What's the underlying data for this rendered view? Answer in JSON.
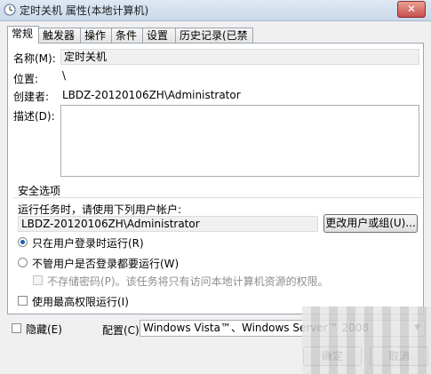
{
  "window": {
    "title": "定时关机 属性(本地计算机)",
    "close_glyph": "✕"
  },
  "tabs": [
    {
      "label": "常规"
    },
    {
      "label": "触发器"
    },
    {
      "label": "操作"
    },
    {
      "label": "条件"
    },
    {
      "label": "设置"
    },
    {
      "label": "历史记录(已禁用)"
    }
  ],
  "general": {
    "name_label": "名称(M):",
    "name_value": "定时关机",
    "location_label": "位置:",
    "location_value": "\\",
    "author_label": "创建者:",
    "author_value": "LBDZ-20120106ZH\\Administrator",
    "description_label": "描述(D):",
    "description_value": ""
  },
  "security": {
    "section_title": "安全选项",
    "run_as_label": "运行任务时，请使用下列用户帐户:",
    "user_account": "LBDZ-20120106ZH\\Administrator",
    "change_user_button": "更改用户或组(U)...",
    "radio_logged_on": "只在用户登录时运行(R)",
    "radio_logged_on_selected": true,
    "radio_whether_logged": "不管用户是否登录都要运行(W)",
    "no_store_password": "不存储密码(P)。该任务将只有访问本地计算机资源的权限。",
    "highest_privileges": "使用最高权限运行(I)"
  },
  "bottom": {
    "hidden_label": "隐藏(E)",
    "configure_label": "配置(C):",
    "configure_value": "Windows Vista™、Windows Server™ 2008",
    "ok_button": "确定",
    "cancel_button": "取消"
  }
}
